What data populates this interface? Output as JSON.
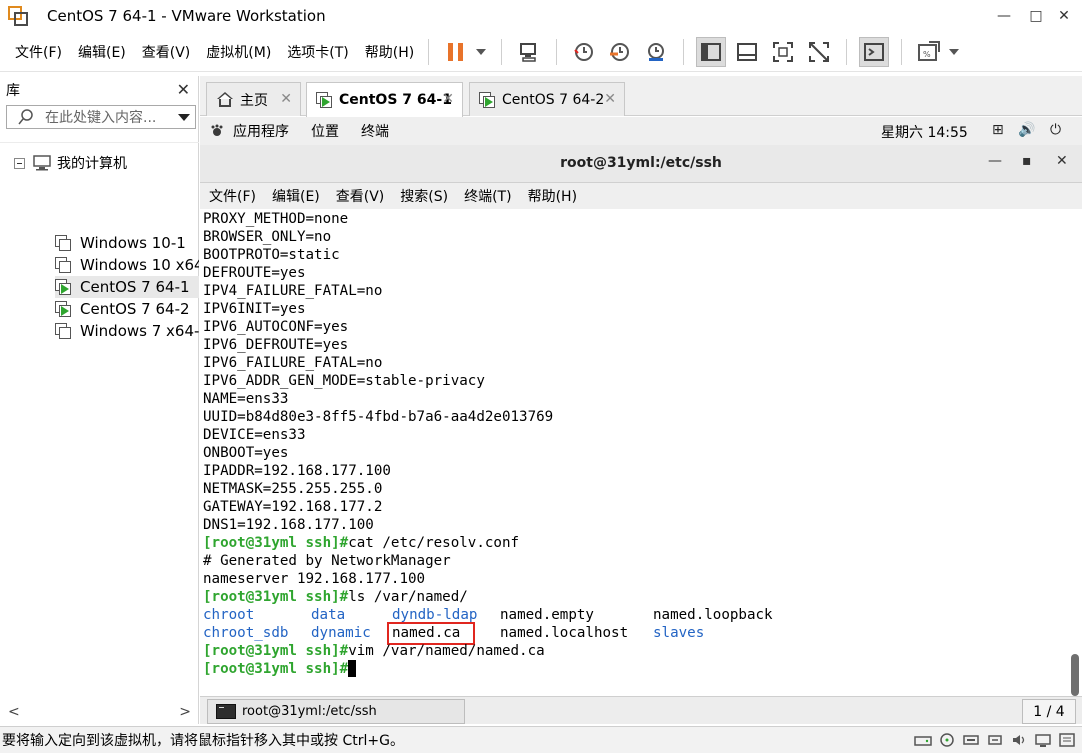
{
  "window": {
    "title": "CentOS 7 64-1 - VMware Workstation",
    "minimize": "—",
    "maximize": "□",
    "close": "✕"
  },
  "menu": {
    "items": [
      "文件(F)",
      "编辑(E)",
      "查看(V)",
      "虚拟机(M)",
      "选项卡(T)",
      "帮助(H)"
    ]
  },
  "library": {
    "title": "库",
    "close": "✕",
    "search_placeholder": "在此处键入内容...",
    "root": "我的计算机",
    "vms": [
      "Windows 10-1",
      "Windows 10 x64",
      "CentOS 7 64-1",
      "CentOS 7 64-2",
      "Windows 7 x64-"
    ],
    "scroll_left": "<",
    "scroll_right": ">"
  },
  "tabs": [
    {
      "label": "主页"
    },
    {
      "label": "CentOS 7 64-1"
    },
    {
      "label": "CentOS 7 64-2"
    }
  ],
  "tab_close": "✕",
  "gnome": {
    "apps": "应用程序",
    "places": "位置",
    "terminal": "终端",
    "clock": "星期六 14:55",
    "tray": [
      "⊞",
      "🔊",
      "⏻"
    ]
  },
  "terminal_window": {
    "title": "root@31yml:/etc/ssh",
    "minimize": "—",
    "maximize": "▪",
    "close": "✕",
    "menu": [
      "文件(F)",
      "编辑(E)",
      "查看(V)",
      "搜索(S)",
      "终端(T)",
      "帮助(H)"
    ]
  },
  "terminal": {
    "lines": [
      "PROXY_METHOD=none",
      "BROWSER_ONLY=no",
      "BOOTPROTO=static",
      "DEFROUTE=yes",
      "IPV4_FAILURE_FATAL=no",
      "IPV6INIT=yes",
      "IPV6_AUTOCONF=yes",
      "IPV6_DEFROUTE=yes",
      "IPV6_FAILURE_FATAL=no",
      "IPV6_ADDR_GEN_MODE=stable-privacy",
      "NAME=ens33",
      "UUID=b84d80e3-8ff5-4fbd-b7a6-aa4d2e013769",
      "DEVICE=ens33",
      "ONBOOT=yes",
      "IPADDR=192.168.177.100",
      "NETMASK=255.255.255.0",
      "GATEWAY=192.168.177.2",
      "DNS1=192.168.177.100"
    ],
    "prompt": "[root@31yml ssh]#",
    "cmd_cat": "cat /etc/resolv.conf",
    "out_generated": "# Generated by NetworkManager",
    "out_nameserver": "nameserver 192.168.177.100",
    "cmd_ls": "ls /var/named/",
    "ls_row1": [
      "chroot",
      "data",
      "dyndb-ldap",
      "named.empty",
      "named.loopback"
    ],
    "ls_row2": [
      "chroot_sdb",
      "dynamic",
      "named.ca",
      "named.localhost",
      "slaves"
    ],
    "cmd_vim": "vim /var/named/named.ca"
  },
  "taskbar": {
    "item": "root@31yml:/etc/ssh",
    "pager": "1 / 4"
  },
  "status": {
    "text": "要将输入定向到该虚拟机，请将鼠标指针移入其中或按 Ctrl+G。"
  },
  "colors": {
    "prompt": "#2fa52f",
    "dir": "#2364c4",
    "highlight": "#e0261f",
    "pause": "#e8732a"
  }
}
